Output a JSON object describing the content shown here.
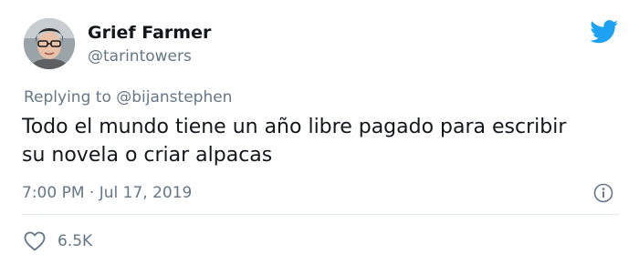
{
  "author": {
    "display_name": "Grief Farmer",
    "handle": "@tarintowers"
  },
  "reply": {
    "prefix": "Replying to",
    "mention": "@bijanstephen"
  },
  "tweet": {
    "text_lines": [
      "Todo el mundo tiene un año libre pagado para escribir",
      "su novela o criar alpacas"
    ],
    "timestamp": "7:00 PM · Jul 17, 2019"
  },
  "stats": {
    "likes": "6.5K"
  },
  "icons": {
    "logo": "twitter-bird-icon",
    "info": "info-icon",
    "like": "heart-icon"
  },
  "colors": {
    "brand": "#1da1f2",
    "text": "#14171a",
    "secondary": "#657786",
    "divider": "#e1e8ed"
  }
}
